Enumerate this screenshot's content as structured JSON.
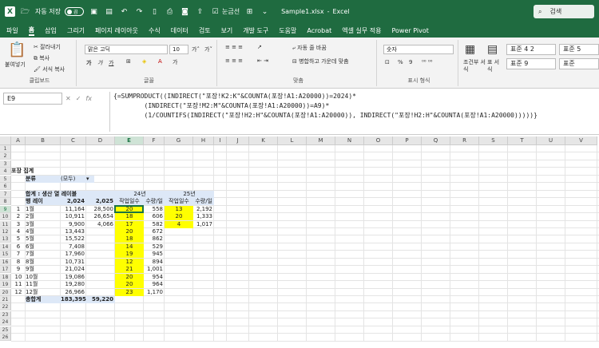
{
  "titlebar": {
    "autosave_label": "자동 저장",
    "autosave_state": "끔",
    "comment_label": "눈금선",
    "filename": "Sample1.xlsx",
    "app_name": "Excel",
    "separator": "-",
    "search_placeholder": "검색"
  },
  "menu": {
    "tabs": [
      "파일",
      "홈",
      "삽입",
      "그리기",
      "페이지 레이아웃",
      "수식",
      "데이터",
      "검토",
      "보기",
      "개발 도구",
      "도움말",
      "Acrobat",
      "엑셀 실무 적용",
      "Power Pivot"
    ],
    "active": "홈"
  },
  "ribbon": {
    "clipboard": {
      "paste": "붙여넣기",
      "cut": "잘라내기",
      "copy": "복사",
      "format_painter": "서식 복사",
      "label": "클립보드"
    },
    "font": {
      "name": "맑은 고딕",
      "size": "10",
      "label": "글꼴",
      "bold": "가",
      "italic": "가",
      "underline": "가",
      "grow": "가˄",
      "shrink": "가˅"
    },
    "alignment": {
      "wrap": "자동 줄 바꿈",
      "merge": "병합하고 가운데 맞춤",
      "label": "맞춤"
    },
    "number": {
      "format": "숫자",
      "label": "표시 형식",
      "percent": "%",
      "comma": "9"
    },
    "styles": {
      "conditional": "조건부 서식",
      "table": "표 서식",
      "style1": "표준 4 2",
      "style2": "표준 5",
      "style3": "표준 9",
      "style4": "표준"
    }
  },
  "formula_bar": {
    "name_box": "E9",
    "fx": "fx",
    "lines": [
      "{=SUMPRODUCT((INDIRECT(\"포장!K2:K\"&COUNTA(포장!A1:A20000))=2024)*",
      "        (INDIRECT(\"포장!M2:M\"&COUNTA(포장!A1:A20000))=A9)*",
      "        (1/COUNTIFS(INDIRECT(\"포장!H2:H\"&COUNTA(포장!A1:A20000)), INDIRECT(\"포장!H2:H\"&COUNTA(포장!A1:A20000)))))}"
    ]
  },
  "sheet": {
    "columns": [
      "A",
      "B",
      "C",
      "D",
      "E",
      "F",
      "G",
      "H",
      "I",
      "J",
      "K",
      "L",
      "M",
      "N",
      "O",
      "P",
      "Q",
      "R",
      "S",
      "T",
      "U",
      "V"
    ],
    "title": "포장 집계",
    "filter_label": "분류",
    "filter_value": "(모두)",
    "pivot_header": "합계 : 생산 열 레이블",
    "row_label": "행 레이",
    "year1": "2,024",
    "year2": "2,025",
    "grp1": "24년",
    "grp2": "25년",
    "col_workdays": "작업일수",
    "col_perday": "수량/일",
    "total_label": "총합계",
    "total_2024": "183,395",
    "total_2025": "59,220",
    "rows": [
      {
        "n": "1",
        "m": "1월",
        "a": "11,164",
        "b": "28,500",
        "e": "20",
        "f": "558",
        "g": "13",
        "h": "2,192"
      },
      {
        "n": "2",
        "m": "2월",
        "a": "10,911",
        "b": "26,654",
        "e": "18",
        "f": "606",
        "g": "20",
        "h": "1,333"
      },
      {
        "n": "3",
        "m": "3월",
        "a": "9,900",
        "b": "4,066",
        "e": "17",
        "f": "582",
        "g": "4",
        "h": "1,017"
      },
      {
        "n": "4",
        "m": "4월",
        "a": "13,443",
        "b": "",
        "e": "20",
        "f": "672",
        "g": "",
        "h": ""
      },
      {
        "n": "5",
        "m": "5월",
        "a": "15,522",
        "b": "",
        "e": "18",
        "f": "862",
        "g": "",
        "h": ""
      },
      {
        "n": "6",
        "m": "6월",
        "a": "7,408",
        "b": "",
        "e": "14",
        "f": "529",
        "g": "",
        "h": ""
      },
      {
        "n": "7",
        "m": "7월",
        "a": "17,960",
        "b": "",
        "e": "19",
        "f": "945",
        "g": "",
        "h": ""
      },
      {
        "n": "8",
        "m": "8월",
        "a": "10,731",
        "b": "",
        "e": "12",
        "f": "894",
        "g": "",
        "h": ""
      },
      {
        "n": "9",
        "m": "9월",
        "a": "21,024",
        "b": "",
        "e": "21",
        "f": "1,001",
        "g": "",
        "h": ""
      },
      {
        "n": "10",
        "m": "10월",
        "a": "19,086",
        "b": "",
        "e": "20",
        "f": "954",
        "g": "",
        "h": ""
      },
      {
        "n": "11",
        "m": "11월",
        "a": "19,280",
        "b": "",
        "e": "20",
        "f": "964",
        "g": "",
        "h": ""
      },
      {
        "n": "12",
        "m": "12월",
        "a": "26,966",
        "b": "",
        "e": "23",
        "f": "1,170",
        "g": "",
        "h": ""
      }
    ]
  }
}
